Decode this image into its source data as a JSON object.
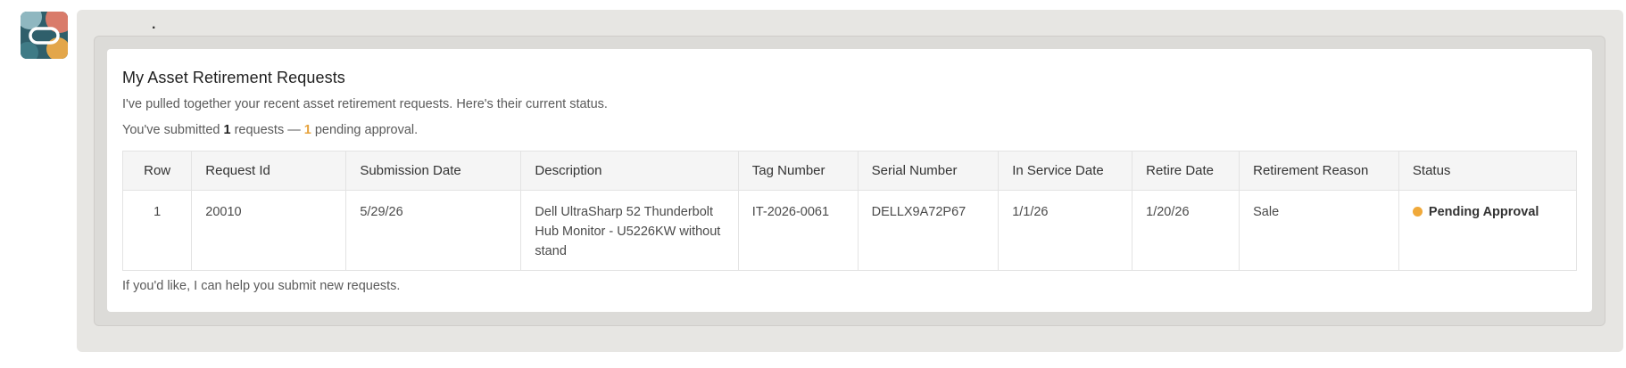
{
  "avatar": {
    "icon": "oracle-logo-icon"
  },
  "message": {
    "leading_dot": ".",
    "title": "My Asset Retirement Requests",
    "intro": "I've pulled together your recent asset retirement requests. Here's their current status.",
    "summary": {
      "prefix": "You've submitted ",
      "submitted_count": "1",
      "middle": " requests — ",
      "pending_count": "1",
      "suffix": " pending approval."
    },
    "footer": "If you'd like, I can help you submit new requests."
  },
  "table": {
    "headers": [
      "Row",
      "Request Id",
      "Submission Date",
      "Description",
      "Tag Number",
      "Serial Number",
      "In Service Date",
      "Retire Date",
      "Retirement Reason",
      "Status"
    ],
    "rows": [
      {
        "row": "1",
        "request_id": "20010",
        "submission_date": "5/29/26",
        "description": "Dell UltraSharp 52 Thunderbolt Hub Monitor - U5226KW without stand",
        "tag_number": "IT-2026-0061",
        "serial_number": "DELLX9A72P67",
        "in_service_date": "1/1/26",
        "retire_date": "1/20/26",
        "retirement_reason": "Sale",
        "status": "Pending Approval",
        "status_color": "#f0a93a"
      }
    ]
  },
  "colors": {
    "accent": "#e6a23c",
    "bubble_background": "#e7e6e3"
  }
}
